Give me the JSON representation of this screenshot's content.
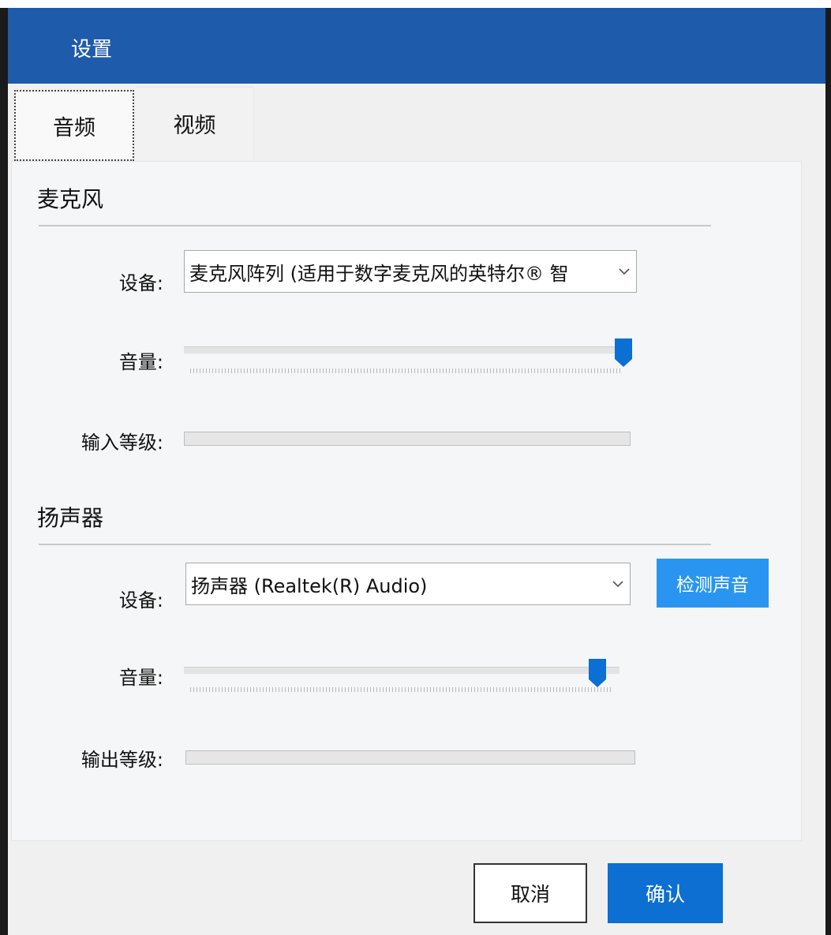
{
  "dialog": {
    "title": "设置"
  },
  "tabs": [
    {
      "label": "音频",
      "selected": true
    },
    {
      "label": "视频",
      "selected": false
    }
  ],
  "microphone": {
    "section_title": "麦克风",
    "device_label": "设备:",
    "device_value": "麦克风阵列 (适用于数字麦克风的英特尔® 智",
    "volume_label": "音量:",
    "volume_level": 1.0,
    "input_level_label": "输入等级:",
    "input_level": 0
  },
  "speaker": {
    "section_title": "扬声器",
    "device_label": "设备:",
    "device_value": "扬声器 (Realtek(R) Audio)",
    "test_button": "检测声音",
    "volume_label": "音量:",
    "volume_level": 0.96,
    "output_level_label": "输出等级:",
    "output_level": 0
  },
  "buttons": {
    "cancel": "取消",
    "confirm": "确认"
  },
  "icons": {
    "dropdown": "chevron-down-icon",
    "slider_thumb": "slider-thumb-icon"
  },
  "colors": {
    "title_bar": "#1e5bab",
    "accent_blue": "#0c6fd1",
    "test_button": "#2a95f1",
    "slider_thumb": "#0b6fd3"
  }
}
